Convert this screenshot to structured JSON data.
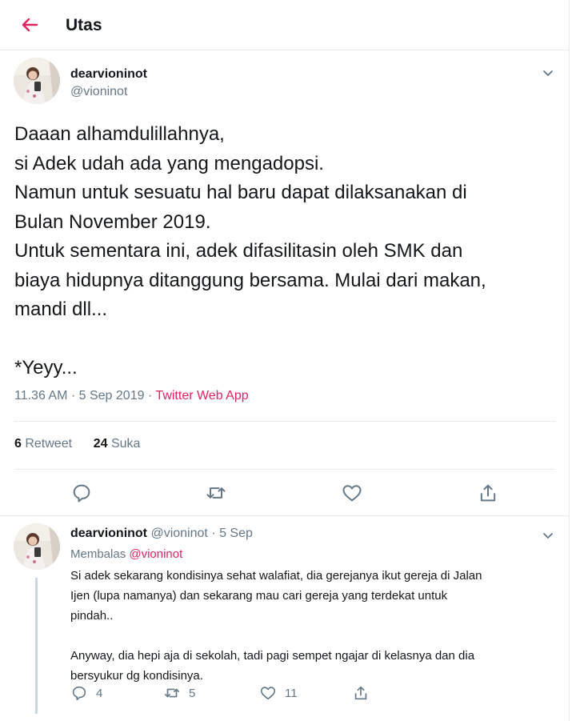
{
  "header": {
    "title": "Utas"
  },
  "tweet": {
    "name": "dearvioninot",
    "handle": "@vioninot",
    "text_lines": [
      "Daaan alhamdulillahnya,",
      "si Adek udah ada yang mengadopsi.",
      "Namun untuk sesuatu hal baru dapat dilaksanakan di",
      "Bulan November 2019.",
      "Untuk sementara ini, adek difasilitasin oleh SMK dan",
      "biaya hidupnya ditanggung bersama. Mulai dari makan,",
      "mandi dll...",
      "",
      "*Yeyy..."
    ],
    "timestamp": "11.36 AM · 5 Sep 2019 · ",
    "source": "Twitter Web App",
    "retweet_count": "6",
    "retweet_label": " Retweet",
    "like_count": "24",
    "like_label": " Suka"
  },
  "reply": {
    "name": "dearvioninot",
    "handle_time": " @vioninot · 5 Sep",
    "replying_label": "Membalas ",
    "replying_to": "@vioninot",
    "text_lines": [
      "Si adek sekarang kondisinya sehat walafiat, dia gerejanya ikut gereja di Jalan",
      "Ijen (lupa namanya) dan sekarang mau cari gereja yang terdekat untuk",
      "pindah..",
      "",
      "Anyway, dia hepi aja di sekolah, tadi pagi sempet ngajar di kelasnya dan dia",
      "bersyukur dg kondisinya."
    ],
    "reply_count": "4",
    "retweet_count": "5",
    "like_count": "11"
  },
  "colors": {
    "accent": "#e0245e",
    "muted": "#657786",
    "border": "#e6ecf0",
    "text": "#14171a"
  },
  "icons": [
    "back-arrow-icon",
    "chevron-down-icon",
    "reply-icon",
    "retweet-icon",
    "like-icon",
    "share-icon"
  ]
}
